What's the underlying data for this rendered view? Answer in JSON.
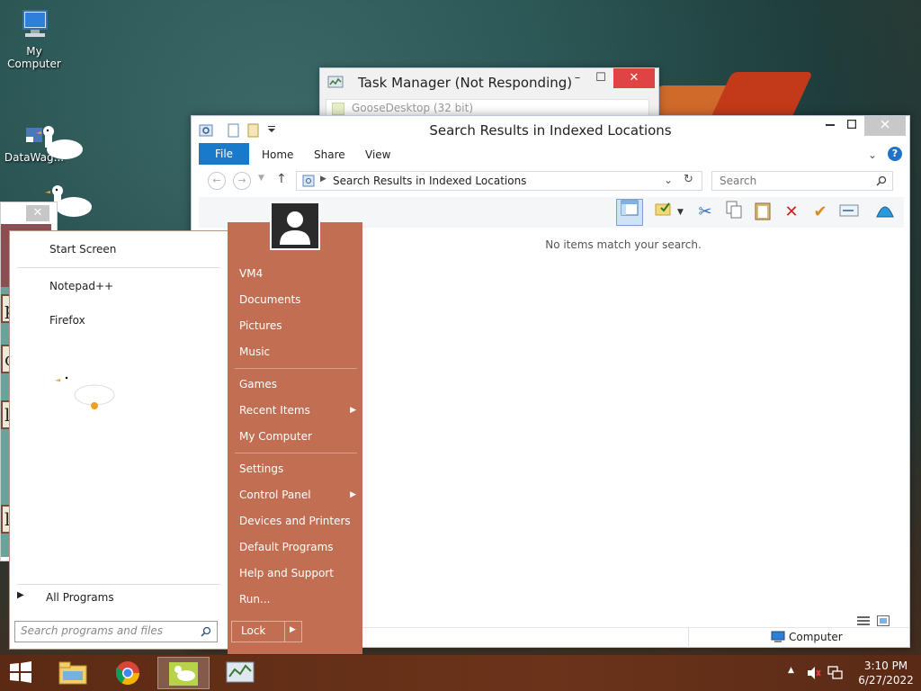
{
  "desktop": {
    "icons": [
      {
        "label": "My Computer"
      },
      {
        "label": "DataWag..."
      }
    ]
  },
  "task_manager": {
    "title": "Task Manager (Not Responding)",
    "row_label": "GooseDesktop (32 bit)",
    "min": "–",
    "max": "☐",
    "close": "✕"
  },
  "explorer": {
    "title": "Search Results in Indexed Locations",
    "tabs": {
      "file": "File",
      "home": "Home",
      "share": "Share",
      "view": "View"
    },
    "address": "Search Results in Indexed Locations",
    "search_placeholder": "Search",
    "empty_message": "No items match your search.",
    "status_location": "Computer",
    "help": "?",
    "chevron": "⌄"
  },
  "game_window": {
    "close": "✕",
    "cards": [
      "ple",
      "ot",
      "l",
      "l"
    ]
  },
  "start_menu": {
    "left_items": [
      "Start Screen",
      "Notepad++",
      "Firefox"
    ],
    "all_programs": "All Programs",
    "search_placeholder": "Search programs and files",
    "right_items": [
      {
        "label": "VM4"
      },
      {
        "label": "Documents"
      },
      {
        "label": "Pictures"
      },
      {
        "label": "Music"
      },
      {
        "label": "Games"
      },
      {
        "label": "Recent Items"
      },
      {
        "label": "My Computer"
      },
      {
        "label": "Settings"
      },
      {
        "label": "Control Panel"
      },
      {
        "label": "Devices and Printers"
      },
      {
        "label": "Default Programs"
      },
      {
        "label": "Help and Support"
      },
      {
        "label": "Run..."
      }
    ],
    "lock": "Lock"
  },
  "taskbar": {
    "time": "3:10 PM",
    "date": "6/27/2022"
  },
  "colors": {
    "start_right_bg": "#c26e52",
    "file_tab": "#1979ca",
    "close_red": "#e04343",
    "taskbar": "#5c2a14"
  }
}
